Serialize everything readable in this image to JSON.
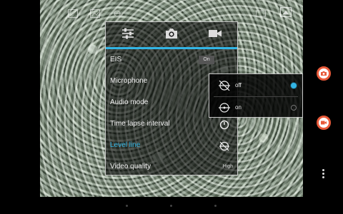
{
  "settings": {
    "tabs": [
      {
        "name": "settings-sliders"
      },
      {
        "name": "photo-camera"
      },
      {
        "name": "video-camera"
      }
    ],
    "active_tab": "video-camera",
    "rows": [
      {
        "label": "EIS",
        "value": "On"
      },
      {
        "label": "Microphone"
      },
      {
        "label": "Audio mode"
      },
      {
        "label": "Time lapse interval"
      },
      {
        "label": "Level line"
      },
      {
        "label": "Video quality",
        "value": "High"
      }
    ]
  },
  "popup": {
    "options": [
      {
        "label": "off",
        "selected": true
      },
      {
        "label": "on",
        "selected": false
      }
    ]
  },
  "colors": {
    "accent": "#33b5e5",
    "panel_border": "#dcdcdc",
    "shutter_ring": "#e85a3a"
  },
  "icons": {
    "top_bar": [
      "exposure-icon",
      "image-icon",
      "scene-icon",
      "hdr-icon",
      "thumbnail-icon"
    ],
    "popup_off": "level-line-off-icon",
    "popup_on": "level-line-on-icon"
  }
}
